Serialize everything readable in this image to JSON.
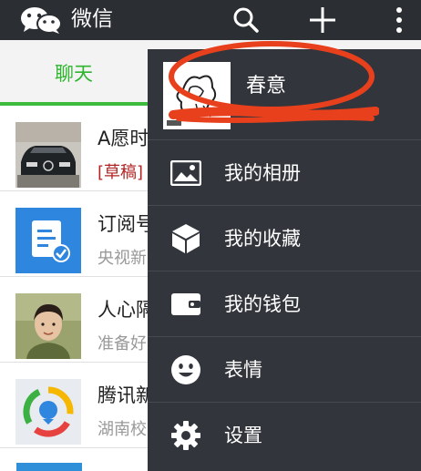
{
  "app": {
    "title": "微信"
  },
  "actionbar": {
    "icons": [
      "wechat-logo-icon",
      "search-icon",
      "plus-icon",
      "more-vertical-icon"
    ]
  },
  "tabs": [
    {
      "label": "聊天",
      "active": true,
      "color": "#2eb52e"
    }
  ],
  "chats": [
    {
      "name": "A愿时",
      "preview_draft": "[草稿]",
      "preview": "",
      "avatar": "car-photo"
    },
    {
      "name": "订阅号",
      "preview": "央视新",
      "avatar": "subscription-icon"
    },
    {
      "name": "人心隔",
      "preview": "准备好",
      "avatar": "person-photo"
    },
    {
      "name": "腾讯新",
      "preview": "湖南校",
      "avatar": "tencent-news-icon"
    }
  ],
  "menu": {
    "profile": {
      "name": "春意"
    },
    "items": [
      {
        "label": "我的相册",
        "icon": "photo-album-icon"
      },
      {
        "label": "我的收藏",
        "icon": "favorites-cube-icon"
      },
      {
        "label": "我的钱包",
        "icon": "wallet-icon"
      },
      {
        "label": "表情",
        "icon": "smiley-icon"
      },
      {
        "label": "设置",
        "icon": "settings-gear-icon"
      }
    ]
  },
  "colors": {
    "actionbar": "#2b2e33",
    "menu_bg": "#32363c",
    "accent_green": "#3dbb3d",
    "annotation_red": "#e8401c"
  }
}
